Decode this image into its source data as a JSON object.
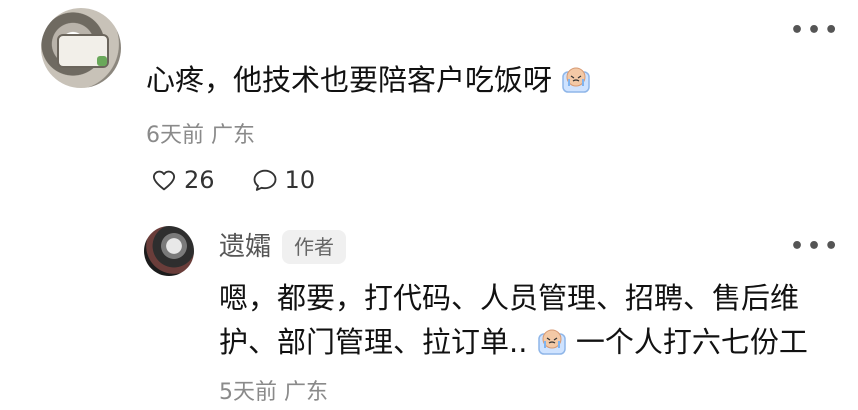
{
  "comment": {
    "username": "",
    "text_before_emoji": "心疼，他技术也要陪客户吃饭呀",
    "emoji": "crying-face-sticker",
    "time": "6天前",
    "location": "广东",
    "likes": "26",
    "replies": "10"
  },
  "reply": {
    "username": "遗孀",
    "author_badge": "作者",
    "line1": "嗯，都要，打代码、人员管理、招聘、售后维",
    "line2_before_emoji": "护、部门管理、拉订单..",
    "emoji": "crying-face-sticker",
    "line2_after_emoji": "一个人打六七份工",
    "time": "5天前",
    "location": "广东"
  },
  "icons": {
    "more": "more-dots-icon",
    "like": "heart-icon",
    "reply": "comment-bubble-icon"
  },
  "colors": {
    "meta_gray": "#8a8a8a",
    "badge_bg": "#f0f0f0"
  }
}
